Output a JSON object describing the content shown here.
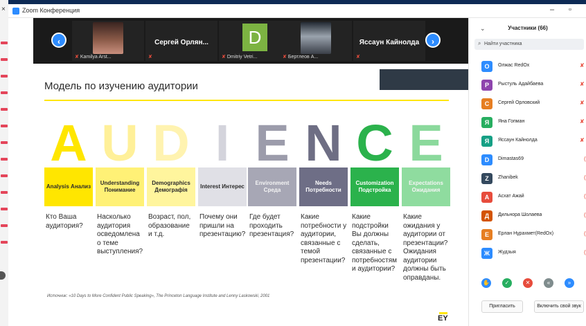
{
  "window": {
    "title": "Zoom Конференция"
  },
  "strip": {
    "tiles": [
      {
        "kind": "photo",
        "caption": "Kamilya Arst..."
      },
      {
        "kind": "name",
        "caption": "Сергей Орлян..."
      },
      {
        "kind": "letter",
        "letter": "D",
        "caption": "Dmitriy Vetri..."
      },
      {
        "kind": "photo",
        "caption": "Бертлеов А..."
      },
      {
        "kind": "name",
        "caption": "Яссаун Кайнолда"
      }
    ]
  },
  "slide": {
    "title": "Модель по изучению аудитории",
    "columns": [
      {
        "letter": "A",
        "letter_color": "#ffe600",
        "label": "Analysis Анализ",
        "label_bg": "#ffe600",
        "label_color": "#2b2b2b",
        "desc": "Кто Ваша аудитория?"
      },
      {
        "letter": "U",
        "letter_color": "#fff099",
        "label": "Understanding Понимание",
        "label_bg": "#fff176",
        "label_color": "#2b2b2b",
        "desc": "Насколько аудитория осведомлена о теме выступления?"
      },
      {
        "letter": "D",
        "letter_color": "#fff3b0",
        "label": "Demographics Демографія",
        "label_bg": "#fff59d",
        "label_color": "#2b2b2b",
        "desc": "Возраст, пол, образование и т.д."
      },
      {
        "letter": "I",
        "letter_color": "#d4d4dc",
        "label": "Interest Интерес",
        "label_bg": "#e0e0e6",
        "label_color": "#2b2b2b",
        "desc": "Почему они пришли на презентацию?"
      },
      {
        "letter": "E",
        "letter_color": "#9c9cab",
        "label": "Environment Среда",
        "label_bg": "#a7a7b5",
        "label_color": "#f5f5f5",
        "desc": "Где будет проходить презентация?"
      },
      {
        "letter": "N",
        "letter_color": "#6e6e84",
        "label": "Needs Потребности",
        "label_bg": "#6e6e86",
        "label_color": "#ffffff",
        "desc": "Какие потребности у аудитории, связанные с темой презентации?"
      },
      {
        "letter": "C",
        "letter_color": "#2bb24c",
        "label": "Customization Подстройка",
        "label_bg": "#2bb24c",
        "label_color": "#ffffff",
        "desc": "Какие подстройки Вы должны сделать, связанные с потребностям и аудитории?"
      },
      {
        "letter": "E",
        "letter_color": "#8bd99c",
        "label": "Expectations Ожидания",
        "label_bg": "#8fdc9f",
        "label_color": "#f5f5f5",
        "desc": "Какие ожидания у аудитории от презентации? Ожидания аудитории должны быть оправданы."
      }
    ],
    "source": "Источник: «10 Days to More Confident Public Speaking», The Princeton Language Institute and Lenny Laskowski, 2001",
    "logo": "EY"
  },
  "panel": {
    "title": "Участники (66)",
    "search_placeholder": "Найти участника",
    "participants": [
      {
        "initial": "O",
        "color": "#2d8cff",
        "name": "Олжас RedOx",
        "muted": true
      },
      {
        "initial": "P",
        "color": "#8e44ad",
        "name": "Рыстуль Адайбаева",
        "muted": true
      },
      {
        "initial": "С",
        "color": "#e67e22",
        "name": "Сергей Орловский",
        "muted": true
      },
      {
        "initial": "Я",
        "color": "#27ae60",
        "name": "Яна Гопман",
        "muted": true
      },
      {
        "initial": "Я",
        "color": "#16a085",
        "name": "Яссаун Кайнолда",
        "muted": true
      },
      {
        "initial": "D",
        "color": "#2d8cff",
        "name": "Dimastas69",
        "muted": false
      },
      {
        "initial": "Z",
        "color": "#34495e",
        "name": "Zhanibek",
        "muted": false
      },
      {
        "initial": "А",
        "color": "#e74c3c",
        "name": "Асхат Ажай",
        "muted": false
      },
      {
        "initial": "Д",
        "color": "#d35400",
        "name": "Дильнора Шолаева",
        "muted": false
      },
      {
        "initial": "Е",
        "color": "#e67e22",
        "name": "Ерлан Нұрахмет(RedOx)",
        "muted": false
      },
      {
        "initial": "Ж",
        "color": "#2d8cff",
        "name": "Жудзыя",
        "muted": false
      }
    ],
    "invite_label": "Пригласить",
    "unmute_label": "Включить свой звук"
  }
}
